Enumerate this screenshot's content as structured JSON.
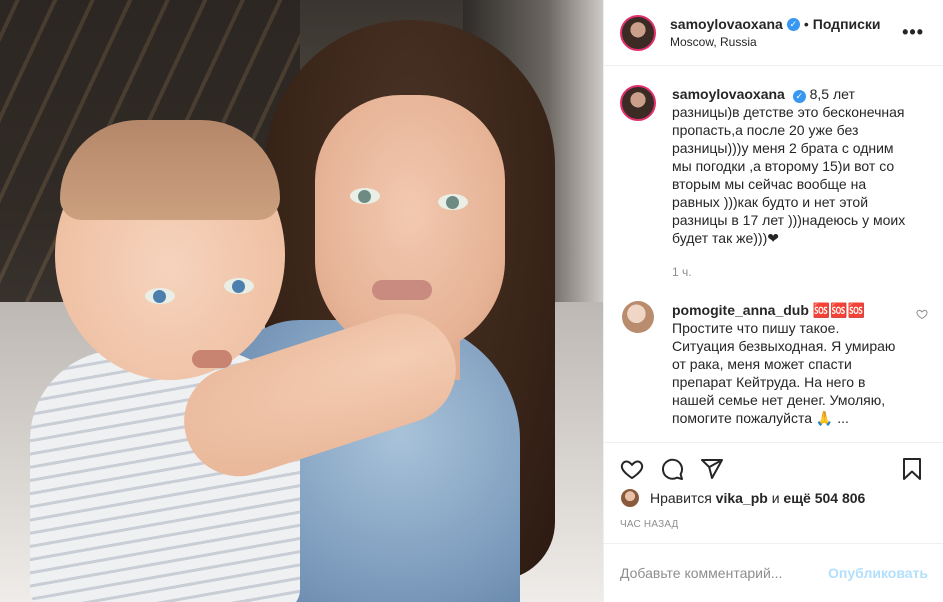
{
  "post": {
    "author": {
      "username": "samoylovaoxana",
      "verified_icon": "verified-badge-icon",
      "separator": "•",
      "follow_label": "Подписки",
      "location": "Moscow, Russia"
    },
    "more_icon": "more-options-icon",
    "more_label": "•••",
    "caption": {
      "username": "samoylovaoxana",
      "text": "8,5 лет разницы)в детстве это бесконечная пропасть,а после 20 уже без разницы)))у меня 2 брата с одним мы погодки ,а второму 15)и вот со вторым мы сейчас вообще на равных )))как будто и нет этой разницы в 17 лет )))надеюсь у моих будет так же)))❤",
      "time": "1 ч."
    },
    "comments": [
      {
        "username": "pomogite_anna_dub",
        "suffix": "🆘🆘🆘",
        "text": "Простите что пишу такое. Ситуация безвыходная. Я умираю от рака, меня может спасти препарат Кейтруда. На него в нашей семье нет денег. Умоляю, помогите пожалуйста 🙏 ...",
        "heart_icon": "heart-outline-icon"
      }
    ],
    "actions": {
      "like_icon": "heart-icon",
      "comment_icon": "comment-icon",
      "share_icon": "share-icon",
      "save_icon": "bookmark-icon"
    },
    "likes": {
      "prefix": "Нравится",
      "user": "vika_pb",
      "middle": "и",
      "rest": "ещё 504 806"
    },
    "timestamp": "ЧАС НАЗАД",
    "add_comment": {
      "placeholder": "Добавьте комментарий...",
      "publish_label": "Опубликовать"
    }
  },
  "colors": {
    "accent_blue": "#3897f0",
    "publish_disabled": "#b2dffc",
    "muted_text": "#8e8e8e",
    "story_ring": "#e1306c"
  }
}
